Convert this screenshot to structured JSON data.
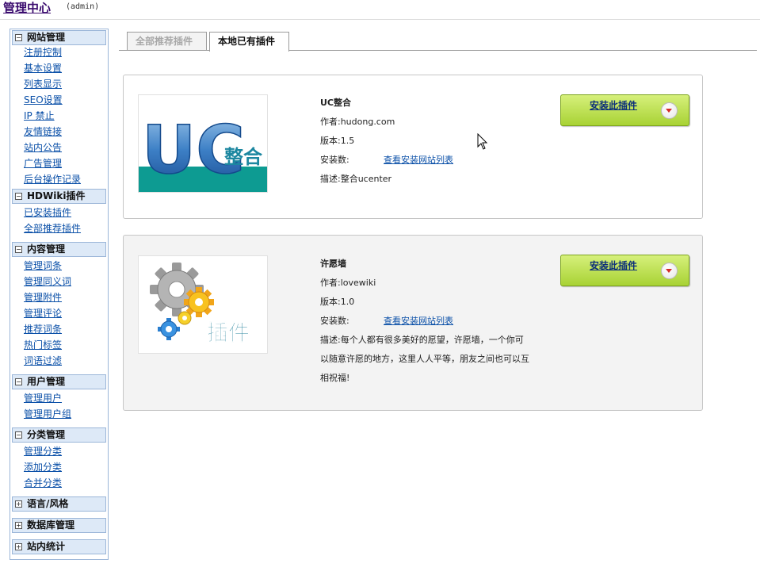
{
  "header": {
    "title": "管理中心",
    "user": "(admin)"
  },
  "sidebar": {
    "groups": [
      {
        "title": "网站管理",
        "toggle": "−",
        "items": [
          "注册控制",
          "基本设置",
          "列表显示",
          "SEO设置",
          "IP 禁止",
          "友情链接",
          "站内公告",
          "广告管理",
          "后台操作记录"
        ]
      },
      {
        "title": "HDWiki插件",
        "toggle": "−",
        "items": [
          "已安装插件",
          "全部推荐插件"
        ]
      },
      {
        "title": "内容管理",
        "toggle": "−",
        "items": [
          "管理词条",
          "管理同义词",
          "管理附件",
          "管理评论",
          "推荐词条",
          "热门标签",
          "词语过滤"
        ]
      },
      {
        "title": "用户管理",
        "toggle": "−",
        "items": [
          "管理用户",
          "管理用户组"
        ]
      },
      {
        "title": "分类管理",
        "toggle": "−",
        "items": [
          "管理分类",
          "添加分类",
          "合并分类"
        ]
      },
      {
        "title": "语言/风格",
        "toggle": "+",
        "items": []
      },
      {
        "title": "数据库管理",
        "toggle": "+",
        "items": []
      },
      {
        "title": "站内统计",
        "toggle": "+",
        "items": []
      }
    ]
  },
  "tabs": [
    {
      "label": "全部推荐插件",
      "active": false
    },
    {
      "label": "本地已有插件",
      "active": true
    }
  ],
  "plugins": [
    {
      "logo_text_big": "UC",
      "logo_text_small": "整合",
      "name": "UC整合",
      "author": "作者:hudong.com",
      "version": "版本:1.5",
      "installs_label": "安装数:",
      "installs_link": "查看安装网站列表",
      "desc_lines": [
        "描述:整合ucenter"
      ],
      "install_label": "安装此插件"
    },
    {
      "logo_text_small": "插件",
      "name": "许愿墙",
      "author": "作者:lovewiki",
      "version": "版本:1.0",
      "installs_label": "安装数:",
      "installs_link": "查看安装网站列表",
      "desc_lines": [
        "描述:每个人都有很多美好的愿望，许愿墙，一个你可",
        "以随意许愿的地方，这里人人平等，朋友之间也可以互",
        "相祝福!"
      ],
      "install_label": "安装此插件"
    }
  ],
  "colors": {
    "accent_link": "#0b50a8",
    "brand": "#3a0b6e",
    "button_green": "#a8d234",
    "sidebar_head": "#dde9f7"
  }
}
